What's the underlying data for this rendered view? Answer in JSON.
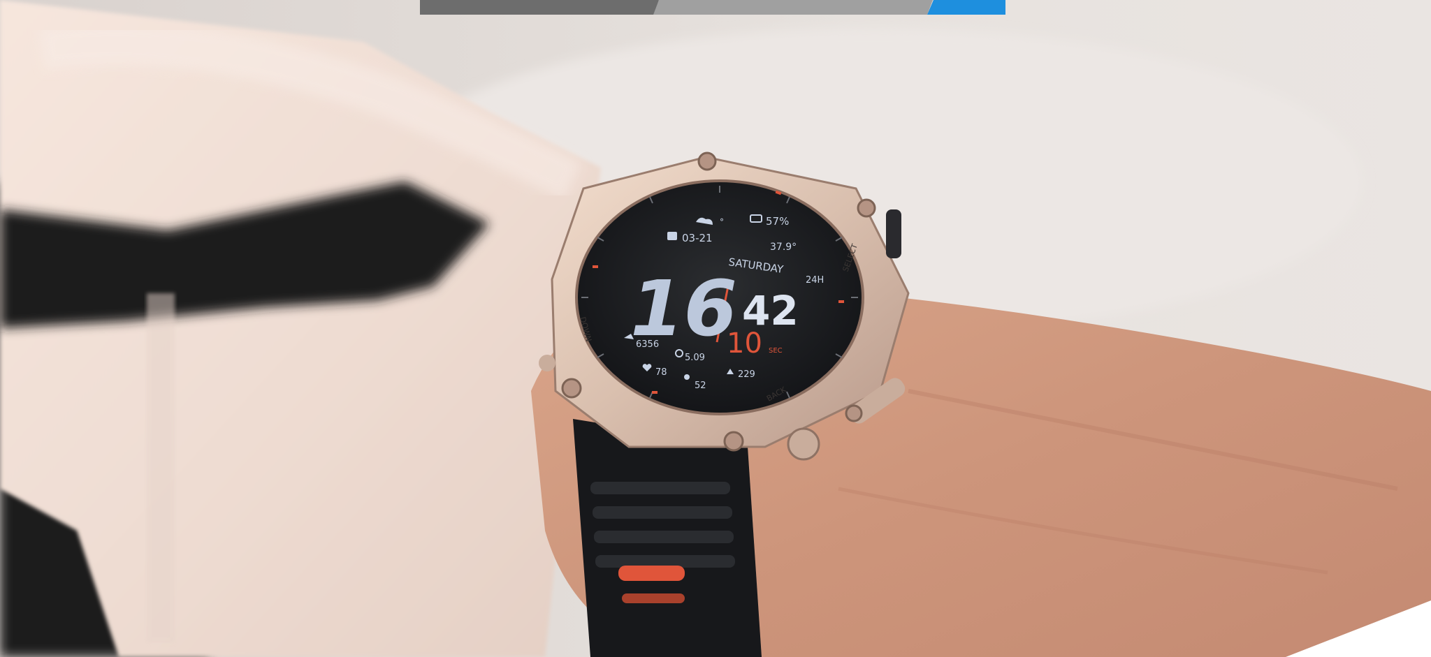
{
  "watch_face": {
    "hour": "16",
    "minute": "42",
    "second": "10",
    "date": "03-21",
    "weekday": "SATURDAY",
    "battery": "57%",
    "temperature_high": "37.9°",
    "temp_label": "°",
    "format": "24H",
    "steps": "6356",
    "distance": "5.09",
    "heart_rate": "78",
    "calories": "229",
    "floors": "52",
    "seconds_suffix": "SEC"
  },
  "bezel_labels": {
    "select": "SELECT",
    "down": "DOWN",
    "back": "BACK"
  },
  "colors": {
    "accent_blue": "#1e8fde",
    "dark_gray": "#6d6d6d",
    "light_gray": "#a0a0a0",
    "watch_red": "#e0553a",
    "dial_text": "#c9d4e6"
  }
}
